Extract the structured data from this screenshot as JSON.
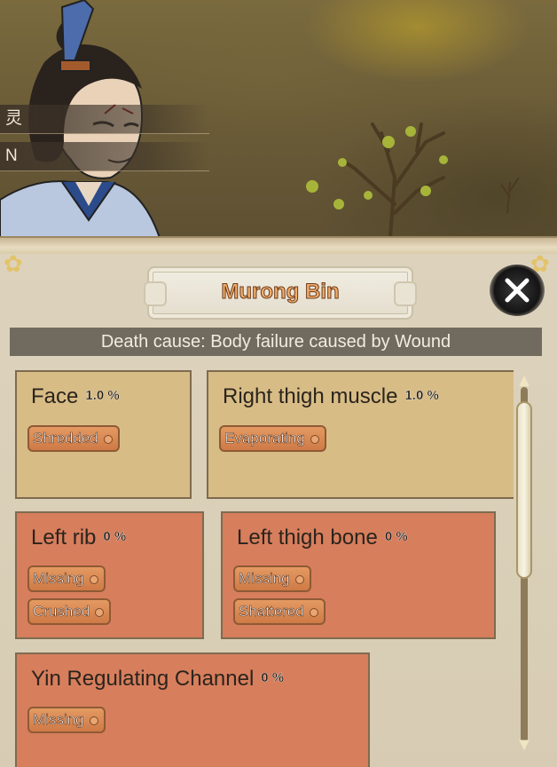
{
  "scene": {
    "name_line1": "灵",
    "name_line2": "N"
  },
  "panel": {
    "character_name": "Murong Bin",
    "death_cause": "Death cause: Body failure caused by Wound"
  },
  "injuries": [
    {
      "part": "Face",
      "percent": "1.0 %",
      "severity": "minor",
      "tags": [
        "Shredded"
      ]
    },
    {
      "part": "Right thigh muscle",
      "percent": "1.0 %",
      "severity": "minor",
      "tags": [
        "Evaporating"
      ]
    },
    {
      "part": "Left rib",
      "percent": "0 %",
      "severity": "severe",
      "tags": [
        "Missing",
        "Crushed"
      ]
    },
    {
      "part": "Left thigh bone",
      "percent": "0 %",
      "severity": "severe",
      "tags": [
        "Missing",
        "Shattered"
      ]
    },
    {
      "part": "Yin Regulating Channel",
      "percent": "0 %",
      "severity": "severe",
      "tags": [
        "Missing"
      ]
    }
  ],
  "colors": {
    "minor_card": "#d8bc86",
    "severe_card": "#d77e5d",
    "title_text": "#f2ad6a"
  },
  "icons": {
    "close": "close-x-icon",
    "scroll_up": "arrow-up-icon",
    "scroll_down": "arrow-down-icon"
  }
}
